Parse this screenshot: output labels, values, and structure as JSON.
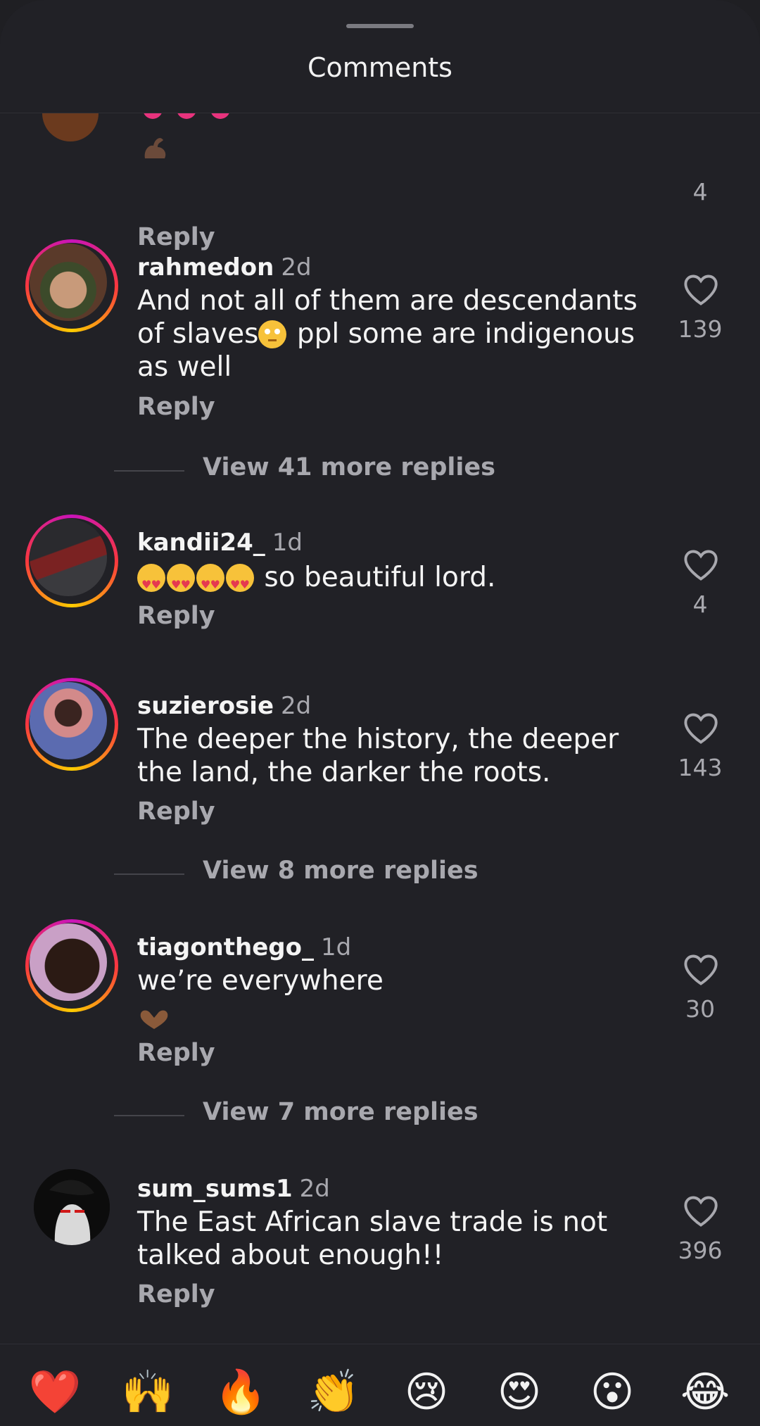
{
  "header": {
    "title": "Comments"
  },
  "top_partial": {
    "likes": "4",
    "reply_label": "Reply"
  },
  "comments": [
    {
      "username": "rahmedon",
      "time": "2d",
      "text_lines": [
        "And not all of them are descendants",
        "of slaves",
        "ppl some are indigenous",
        "as well"
      ],
      "likes": "139",
      "reply_label": "Reply",
      "view_more": "View 41 more replies"
    },
    {
      "username": "kandii24_",
      "time": "1d",
      "text": "so beautiful  lord.",
      "likes": "4",
      "reply_label": "Reply"
    },
    {
      "username": "suzierosie",
      "time": "2d",
      "text_lines": [
        "The deeper the history, the deeper",
        "the land, the darker the roots."
      ],
      "likes": "143",
      "reply_label": "Reply",
      "view_more": "View 8 more replies"
    },
    {
      "username": "tiagonthego_",
      "time": "1d",
      "text": "we’re everywhere",
      "likes": "30",
      "reply_label": "Reply",
      "view_more": "View 7 more replies"
    },
    {
      "username": "sum_sums1",
      "time": "2d",
      "text_lines": [
        "The East African slave trade is not",
        "talked about enough!!"
      ],
      "likes": "396",
      "reply_label": "Reply"
    }
  ],
  "reactions": [
    "❤️",
    "🙌",
    "🔥",
    "👏",
    "😢",
    "😍",
    "😮",
    "😂"
  ]
}
